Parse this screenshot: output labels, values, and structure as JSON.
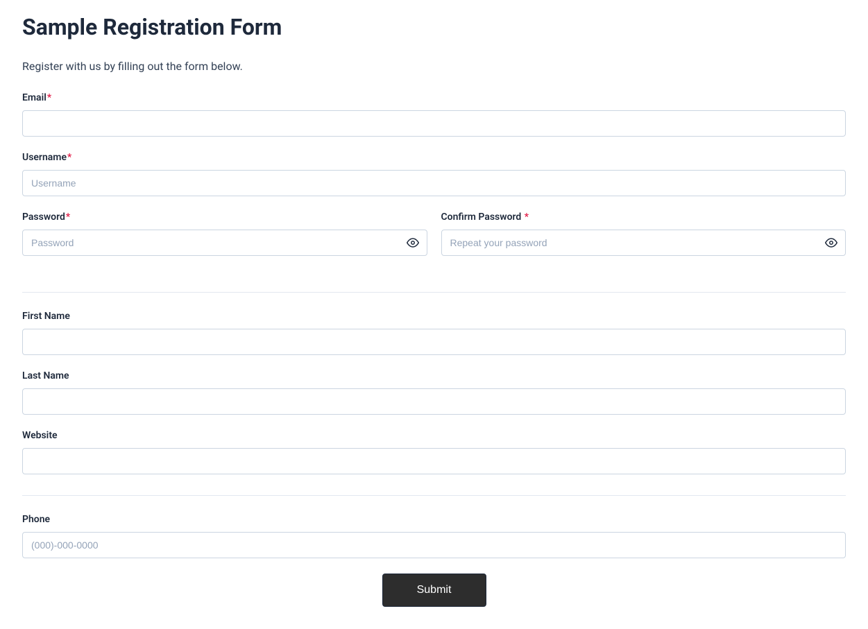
{
  "header": {
    "title": "Sample Registration Form",
    "subtitle": "Register with us by filling out the form below."
  },
  "fields": {
    "email": {
      "label": "Email",
      "required_marker": "*",
      "placeholder": "",
      "value": ""
    },
    "username": {
      "label": "Username",
      "required_marker": "*",
      "placeholder": "Username",
      "value": ""
    },
    "password": {
      "label": "Password",
      "required_marker": "*",
      "placeholder": "Password",
      "value": ""
    },
    "confirm_password": {
      "label": "Confirm Password ",
      "required_marker": "*",
      "placeholder": "Repeat your password",
      "value": ""
    },
    "first_name": {
      "label": "First Name",
      "placeholder": "",
      "value": ""
    },
    "last_name": {
      "label": "Last Name",
      "placeholder": "",
      "value": ""
    },
    "website": {
      "label": "Website",
      "placeholder": "",
      "value": ""
    },
    "phone": {
      "label": "Phone",
      "placeholder": "(000)-000-0000",
      "value": ""
    }
  },
  "actions": {
    "submit_label": "Submit"
  }
}
